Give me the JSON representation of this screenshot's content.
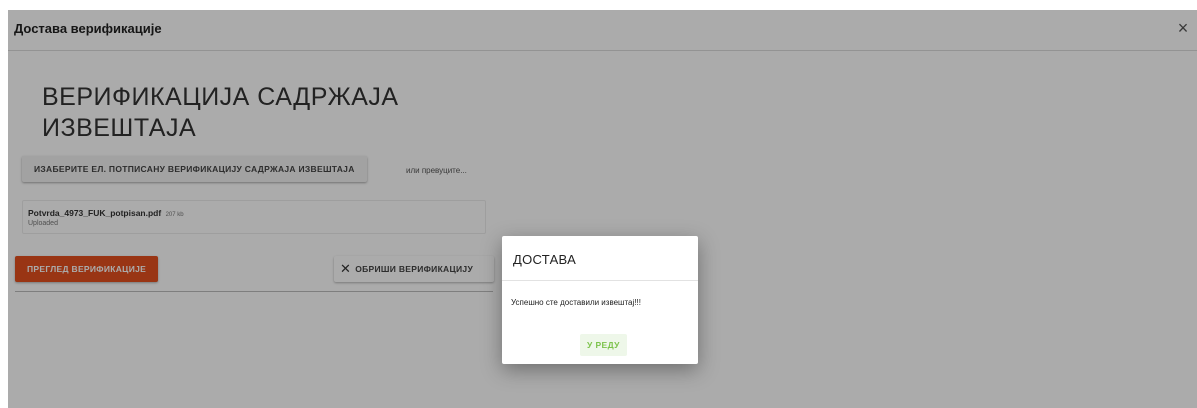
{
  "modal": {
    "title": "Достава верификације",
    "close_label": "×"
  },
  "main": {
    "title": "ВЕРИФИКАЦИЈА САДРЖАЈА ИЗВЕШТАЈА",
    "select_button_label": "ИЗАБЕРИТЕ ЕЛ. ПОТПИСАНУ ВЕРИФИКАЦИЈУ САДРЖАЈА ИЗВЕШТАЈА",
    "drop_hint": "или превуците...",
    "file": {
      "name": "Potvrda_4973_FUK_potpisan.pdf",
      "size": "207 kb",
      "status": "Uploaded"
    },
    "preview_button_label": "ПРЕГЛЕД ВЕРИФИКАЦИЈЕ",
    "delete_button_label": "ОБРИШИ ВЕРИФИКАЦИЈУ"
  },
  "dialog": {
    "title": "ДОСТАВА",
    "message": "Успешно сте доставили извештај!!!",
    "ok_label": "У РЕДУ"
  },
  "colors": {
    "primary_button": "#e5501e",
    "ok_text": "#7cc34b"
  }
}
